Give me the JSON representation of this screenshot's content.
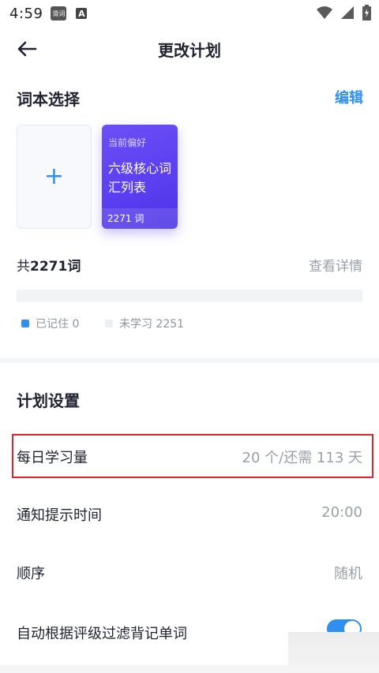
{
  "status_bar": {
    "time": "4:59",
    "notif_1": "滑词",
    "notif_2": "A",
    "icons": [
      "wifi-icon",
      "signal-icon",
      "battery-charging-icon"
    ]
  },
  "header": {
    "title": "更改计划",
    "back_icon": "arrow-left-icon"
  },
  "wordbook": {
    "section_title": "词本选择",
    "edit_label": "编辑",
    "add_symbol": "+",
    "selected_book": {
      "tag": "当前偏好",
      "name": "六级核心词汇列表",
      "count_label": "2271 词"
    },
    "total_prefix": "共",
    "total_value": "2271词",
    "detail_label": "查看详情",
    "progress_fraction": 0,
    "legend": [
      {
        "label": "已记住 0",
        "color": "#2f8ff0"
      },
      {
        "label": "未学习 2251",
        "color": "#eeeff2"
      }
    ]
  },
  "plan": {
    "section_title": "计划设置",
    "rows": [
      {
        "label": "每日学习量",
        "value": "20 个/还需 113 天"
      },
      {
        "label": "通知提示时间",
        "value": "20:00"
      },
      {
        "label": "顺序",
        "value": "随机"
      },
      {
        "label": "自动根据评级过滤背记单词",
        "value": ""
      }
    ],
    "auto_filter_enabled": true
  },
  "colors": {
    "accent": "#2f8ff0",
    "card_gradient_start": "#6c4ff5",
    "highlight": "#e2232a"
  }
}
